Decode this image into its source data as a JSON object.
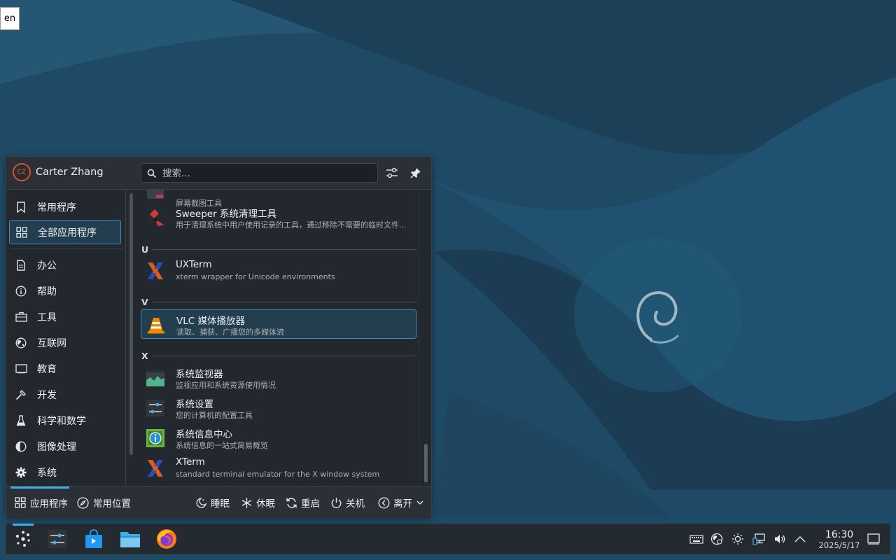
{
  "desktop": {
    "lang_indicator": "en"
  },
  "launcher": {
    "user": {
      "initials": "CZ",
      "name": "Carter Zhang"
    },
    "search": {
      "placeholder": "搜索..."
    },
    "sidebar": [
      {
        "label": "常用程序",
        "icon": "bookmark-icon"
      },
      {
        "label": "全部应用程序",
        "icon": "grid-icon",
        "active": true
      },
      {
        "label": "办公",
        "icon": "office-icon"
      },
      {
        "label": "帮助",
        "icon": "help-icon"
      },
      {
        "label": "工具",
        "icon": "toolbox-icon"
      },
      {
        "label": "互联网",
        "icon": "globe-icon"
      },
      {
        "label": "教育",
        "icon": "education-icon"
      },
      {
        "label": "开发",
        "icon": "hammer-icon"
      },
      {
        "label": "科学和数学",
        "icon": "flask-icon"
      },
      {
        "label": "图像处理",
        "icon": "graphics-icon"
      },
      {
        "label": "系统",
        "icon": "gear-icon"
      }
    ],
    "apps": [
      {
        "name": "",
        "desc": "屏幕截图工具"
      },
      {
        "name": "Sweeper 系统清理工具",
        "desc": "用于清理系统中用户使用记录的工具，通过移除不需要的临时文件..."
      },
      {
        "name": "UXTerm",
        "desc": "xterm wrapper for Unicode environments"
      },
      {
        "name": "VLC 媒体播放器",
        "desc": "读取、捕获、广播您的多媒体流",
        "highlighted": true
      },
      {
        "name": "系统监视器",
        "desc": "监视应用和系统资源使用情况"
      },
      {
        "name": "系统设置",
        "desc": "您的计算机的配置工具"
      },
      {
        "name": "系统信息中心",
        "desc": "系统信息的一站式简易概览"
      },
      {
        "name": "XTerm",
        "desc": "standard terminal emulator for the X window system"
      }
    ],
    "sections": [
      "U",
      "V",
      "X"
    ],
    "footer": {
      "tab_apps": "应用程序",
      "tab_places": "常用位置",
      "sleep": "睡眠",
      "hibernate": "休眠",
      "restart": "重启",
      "shutdown": "关机",
      "leave": "离开"
    }
  },
  "taskbar": {
    "clock": {
      "time": "16:30",
      "date": "2025/5/17"
    },
    "accent": "#3daee9"
  }
}
